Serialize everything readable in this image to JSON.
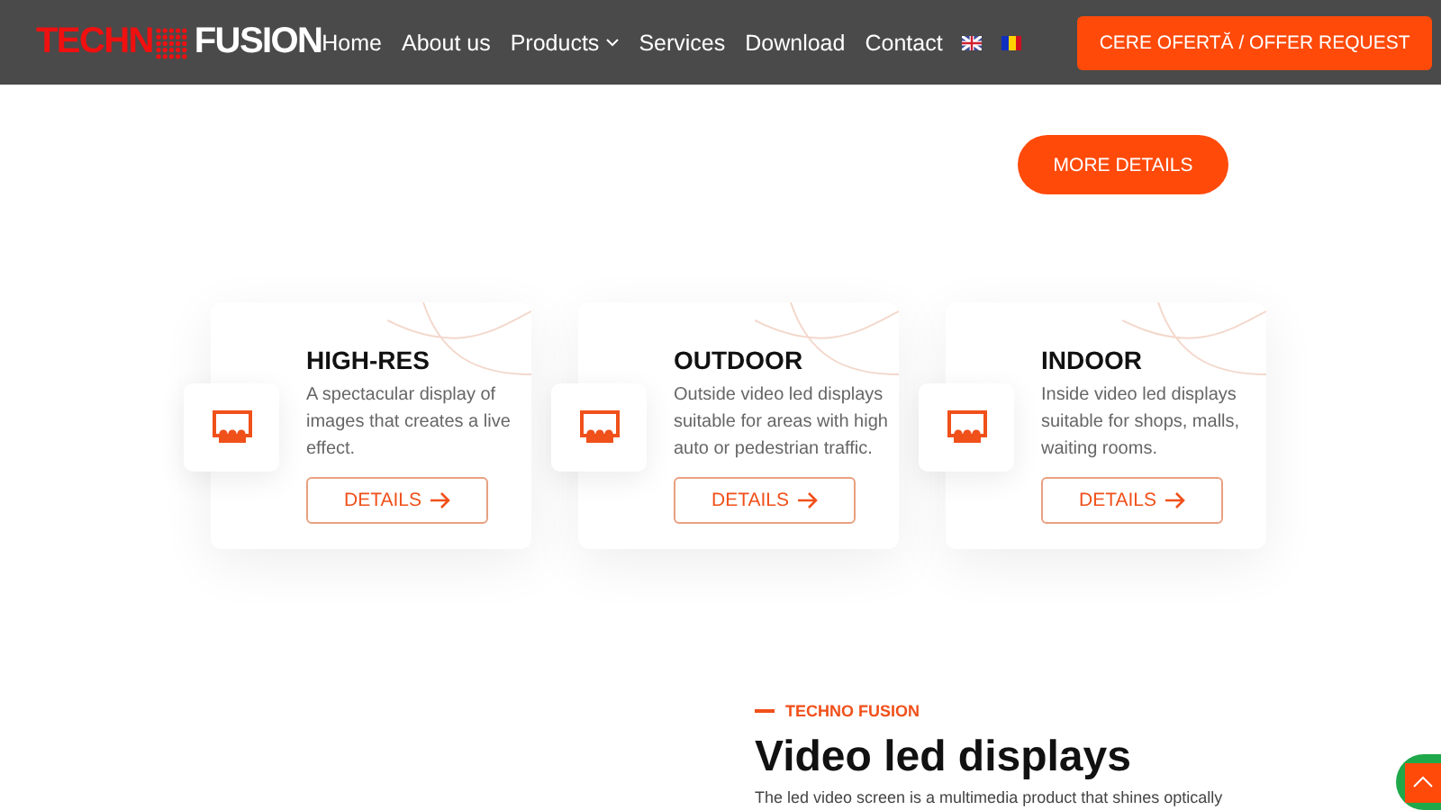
{
  "header": {
    "logo": {
      "part_1": "TECHN",
      "part_2": "FUSION"
    },
    "nav": [
      {
        "label": "Home",
        "has_dropdown": false
      },
      {
        "label": "About us",
        "has_dropdown": false
      },
      {
        "label": "Products",
        "has_dropdown": true
      },
      {
        "label": "Services",
        "has_dropdown": false
      },
      {
        "label": "Download",
        "has_dropdown": false
      },
      {
        "label": "Contact",
        "has_dropdown": false
      }
    ],
    "languages": [
      {
        "kind": "uk"
      },
      {
        "kind": "ro"
      }
    ],
    "cta": "CERE OFERTĂ / OFFER REQUEST"
  },
  "more_details": "MORE DETAILS",
  "features": [
    {
      "title": "HIGH-RES",
      "text": "A spectacular display of images that creates a live effect.",
      "button": "DETAILS"
    },
    {
      "title": "OUTDOOR",
      "text": "Outside video led displays suitable for areas with high auto or pedestrian traffic.",
      "button": "DETAILS"
    },
    {
      "title": "INDOOR",
      "text": "Inside video led displays suitable for shops, malls, waiting rooms.",
      "button": "DETAILS"
    }
  ],
  "section": {
    "eyebrow": "TECHNO FUSION",
    "heading": "Video led displays",
    "text": "The led video screen is a multimedia product that shines optically"
  }
}
